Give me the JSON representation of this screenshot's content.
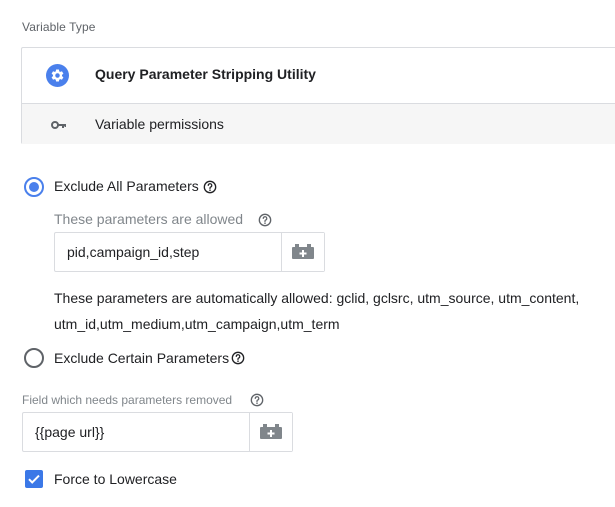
{
  "section": {
    "label": "Variable Type"
  },
  "variable": {
    "name": "Query Parameter Stripping Utility",
    "icon": "gear-icon",
    "icon_color": "#4a80ec",
    "permissions_label": "Variable permissions",
    "permissions_icon": "key-icon"
  },
  "options": {
    "exclude_all": {
      "label": "Exclude All Parameters",
      "selected": true,
      "allowed_label": "These parameters are allowed",
      "allowed_value": "pid,campaign_id,step",
      "auto_allowed_line1": "These parameters are automatically allowed: gclid, gclsrc, utm_source, utm_content,",
      "auto_allowed_line2": "utm_id,utm_medium,utm_campaign,utm_term"
    },
    "exclude_certain": {
      "label": "Exclude Certain Parameters",
      "selected": false
    }
  },
  "field": {
    "label": "Field which needs parameters removed",
    "value": "{{page url}}"
  },
  "force_lowercase": {
    "label": "Force to Lowercase",
    "checked": true
  },
  "colors": {
    "accent": "#4a80ec",
    "checkbox": "#3b78e7",
    "muted_text": "#80868b",
    "border": "#dadce0"
  }
}
